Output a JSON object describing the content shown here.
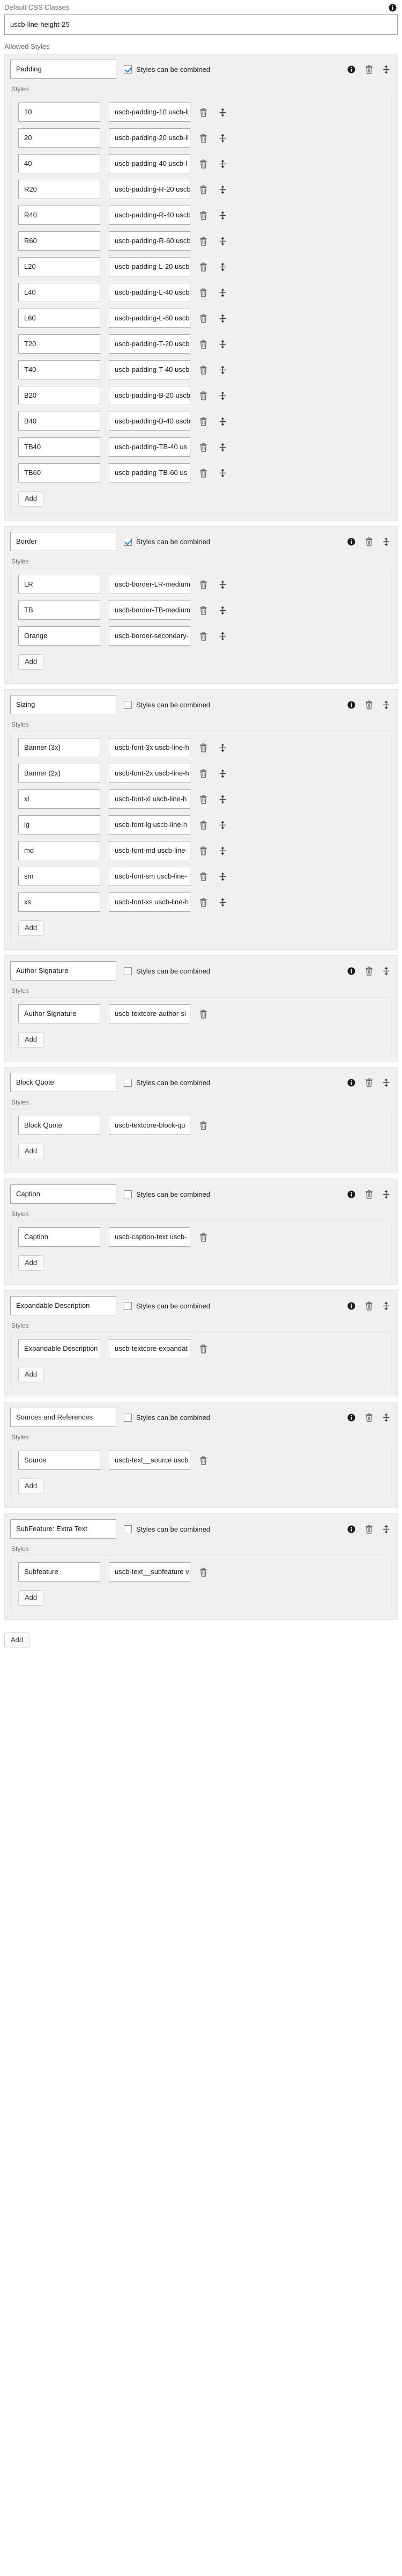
{
  "top": {
    "default_css_classes_label": "Default CSS Classes",
    "default_css_classes_value": "uscb-line-height-25",
    "allowed_styles_label": "Allowed Styles",
    "info_icon": "info-icon"
  },
  "common": {
    "styles_label": "Styles",
    "combine_label": "Styles can be combined",
    "add_label": "Add",
    "info_icon": "info-icon",
    "delete_icon": "trash-icon",
    "reorder_icon": "move-updown-icon"
  },
  "outer_add_label": "Add",
  "colors": {
    "checkbox_check": "#1a73c8",
    "card_background": "#f0f0f0",
    "card_border": "#e2e2e2",
    "input_border": "#a9a9a9",
    "label_text": "#6b6b6b",
    "value_text": "#1a1a1a"
  },
  "groups": [
    {
      "name": "Padding",
      "combined": true,
      "has_reorder": true,
      "styles": [
        {
          "key": "10",
          "value": "uscb-padding-10 uscb-li"
        },
        {
          "key": "20",
          "value": "uscb-padding-20 uscb-li"
        },
        {
          "key": "40",
          "value": "uscb-padding-40 uscb-l"
        },
        {
          "key": "R20",
          "value": "uscb-padding-R-20 uscb"
        },
        {
          "key": "R40",
          "value": "uscb-padding-R-40 uscb"
        },
        {
          "key": "R60",
          "value": "uscb-padding-R-60 uscb"
        },
        {
          "key": "L20",
          "value": "uscb-padding-L-20 uscb"
        },
        {
          "key": "L40",
          "value": "uscb-padding-L-40 uscb"
        },
        {
          "key": "L60",
          "value": "uscb-padding-L-60 uscb"
        },
        {
          "key": "T20",
          "value": "uscb-padding-T-20 uscb"
        },
        {
          "key": "T40",
          "value": "uscb-padding-T-40 uscb"
        },
        {
          "key": "B20",
          "value": "uscb-padding-B-20 uscb"
        },
        {
          "key": "B40",
          "value": "uscb-padding-B-40 uscb"
        },
        {
          "key": "TB40",
          "value": "uscb-padding-TB-40 us"
        },
        {
          "key": "TB60",
          "value": "uscb-padding-TB-60 us"
        }
      ]
    },
    {
      "name": "Border",
      "combined": true,
      "has_reorder": true,
      "styles": [
        {
          "key": "LR",
          "value": "uscb-border-LR-medium"
        },
        {
          "key": "TB",
          "value": "uscb-border-TB-medium"
        },
        {
          "key": "Orange",
          "value": "uscb-border-secondary-"
        }
      ]
    },
    {
      "name": "Sizing",
      "combined": false,
      "has_reorder": true,
      "styles": [
        {
          "key": "Banner (3x)",
          "value": "uscb-font-3x uscb-line-h"
        },
        {
          "key": "Banner (2x)",
          "value": "uscb-font-2x uscb-line-h"
        },
        {
          "key": "xl",
          "value": "uscb-font-xl uscb-line-h"
        },
        {
          "key": "lg",
          "value": "uscb-font-lg uscb-line-h"
        },
        {
          "key": "md",
          "value": "uscb-font-md uscb-line-"
        },
        {
          "key": "sm",
          "value": "uscb-font-sm uscb-line-"
        },
        {
          "key": "xs",
          "value": "uscb-font-xs uscb-line-h"
        }
      ]
    },
    {
      "name": "Author Signature",
      "combined": false,
      "has_reorder": true,
      "styles": [
        {
          "key": "Author Signature",
          "value": "uscb-textcore-author-si"
        }
      ]
    },
    {
      "name": "Block Quote",
      "combined": false,
      "has_reorder": true,
      "styles": [
        {
          "key": "Block Quote",
          "value": "uscb-textcore-block-qu"
        }
      ]
    },
    {
      "name": "Caption",
      "combined": false,
      "has_reorder": true,
      "styles": [
        {
          "key": "Caption",
          "value": "uscb-caption-text uscb-"
        }
      ]
    },
    {
      "name": "Expandable Description",
      "combined": false,
      "has_reorder": true,
      "styles": [
        {
          "key": "Expandable Description",
          "value": "uscb-textcore-expandat"
        }
      ]
    },
    {
      "name": "Sources and References",
      "combined": false,
      "has_reorder": true,
      "styles": [
        {
          "key": "Source",
          "value": "uscb-text__source uscb"
        }
      ]
    },
    {
      "name": "SubFeature: Extra Text",
      "combined": false,
      "has_reorder": true,
      "styles": [
        {
          "key": "Subfeature",
          "value": "uscb-text__subfeature v"
        }
      ]
    }
  ]
}
